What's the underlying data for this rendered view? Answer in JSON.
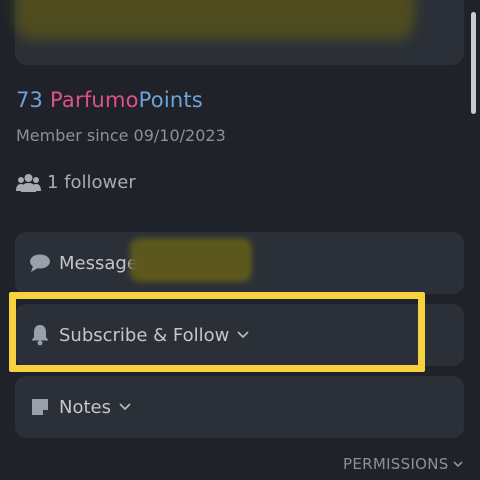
{
  "profile": {
    "points_value": "73",
    "points_brand": "Parfumo",
    "points_suffix": "Points",
    "member_since": "Member since 09/10/2023",
    "followers": "1 follower"
  },
  "actions": {
    "message_label": "Message",
    "subscribe_label": "Subscribe & Follow",
    "notes_label": "Notes"
  },
  "footer": {
    "permissions_label": "PERMISSIONS"
  },
  "colors": {
    "background": "#1f2329",
    "card": "#2b3038",
    "points_blue": "#6ea2d9",
    "brand_pink": "#e0508b",
    "highlight_yellow": "#f5d23e"
  },
  "icons": [
    "users-icon",
    "speech-bubble-icon",
    "bell-icon",
    "note-icon",
    "chevron-down-icon"
  ]
}
